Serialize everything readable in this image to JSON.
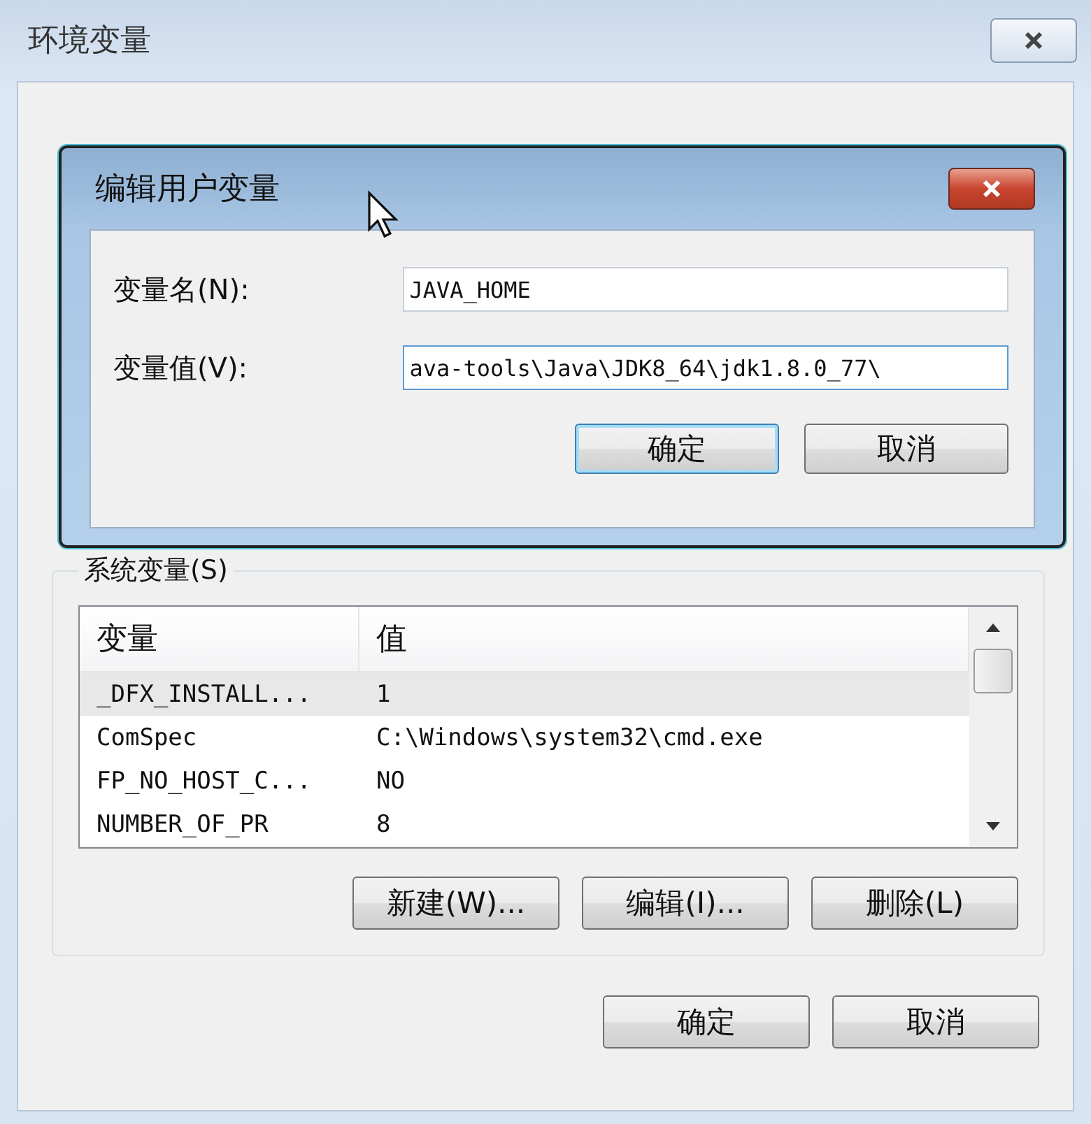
{
  "window": {
    "title": "环境变量"
  },
  "edit_dialog": {
    "title": "编辑用户变量",
    "fields": [
      {
        "label": "变量名(N):",
        "value": "JAVA_HOME"
      },
      {
        "label": "变量值(V):",
        "value": "ava-tools\\Java\\JDK8_64\\jdk1.8.0_77\\"
      }
    ],
    "buttons": [
      {
        "label": "确定",
        "default": true
      },
      {
        "label": "取消",
        "default": false
      }
    ]
  },
  "system_variables": {
    "title": "系统变量(S)",
    "columns": [
      "变量",
      "值"
    ],
    "rows": [
      {
        "name": "_DFX_INSTALL...",
        "value": "1",
        "selected": true
      },
      {
        "name": "ComSpec",
        "value": "C:\\Windows\\system32\\cmd.exe",
        "selected": false
      },
      {
        "name": "FP_NO_HOST_C...",
        "value": "NO",
        "selected": false
      },
      {
        "name": "NUMBER_OF_PR",
        "value": "8",
        "selected": false
      }
    ],
    "buttons": [
      "新建(W)...",
      "编辑(I)...",
      "删除(L)"
    ]
  },
  "buttons": [
    {
      "label": "确定",
      "default": false
    },
    {
      "label": "取消",
      "default": false
    }
  ]
}
